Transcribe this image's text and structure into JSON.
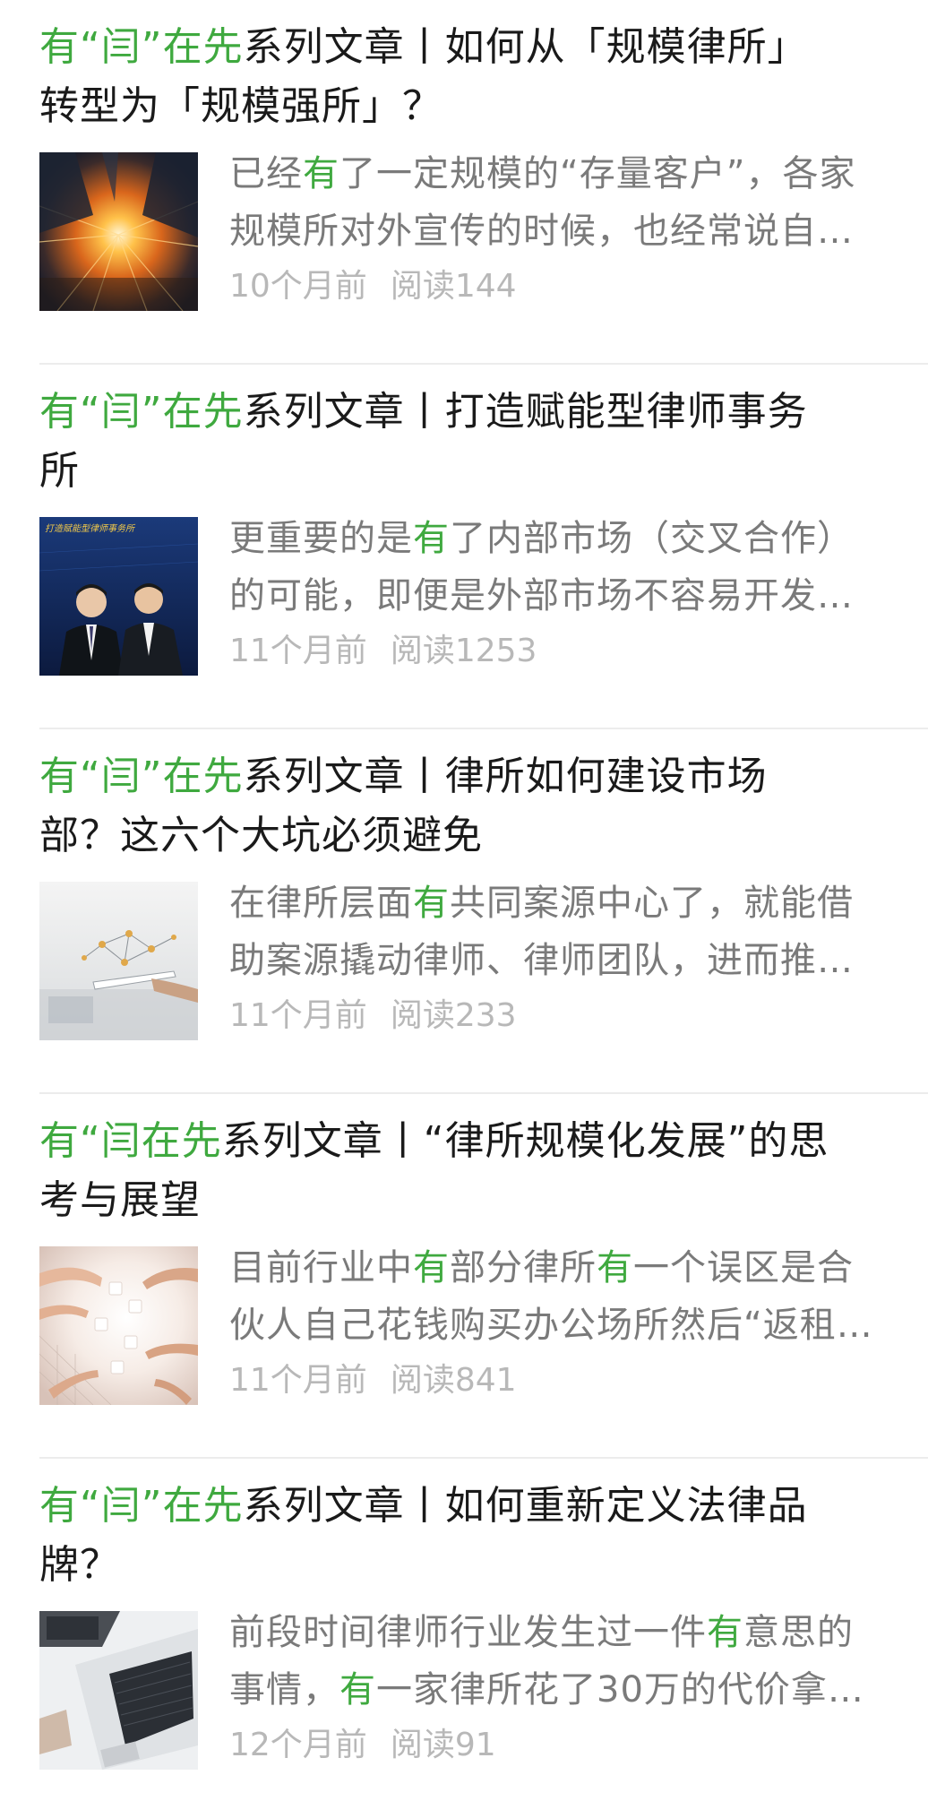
{
  "colors": {
    "highlight": "#3fa93f",
    "title_text": "#1a1a1a",
    "excerpt_text": "#7a7a7a",
    "meta_text": "#b8b8b8",
    "divider": "#ececec"
  },
  "articles": [
    {
      "title_prefix": "有“闫”在先",
      "title_rest_line1": "系列文章丨如何从「规模律所」",
      "title_line2": "转型为「规模强所」？",
      "thumbnail_icon": "city-sunrise-image",
      "excerpt_line1_pre": "已经",
      "excerpt_line1_hl": "有",
      "excerpt_line1_post": "了一定规模的“存量客户”，各家",
      "excerpt_line2": "规模所对外宣传的时候，也经常说自…",
      "time_ago": "10个月前",
      "reads": "阅读144"
    },
    {
      "title_prefix": "有“闫”在先",
      "title_rest_line1": "系列文章丨打造赋能型律师事务",
      "title_line2": "所",
      "thumbnail_icon": "two-lawyers-poster-image",
      "thumbnail_caption": "打造赋能型律师事务所",
      "excerpt_line1_pre": "更重要的是",
      "excerpt_line1_hl": "有",
      "excerpt_line1_post": "了内部市场（交叉合作）",
      "excerpt_line2": "的可能，即便是外部市场不容易开发…",
      "time_ago": "11个月前",
      "reads": "阅读1253"
    },
    {
      "title_prefix": "有“闫”在先",
      "title_rest_line1": "系列文章丨律所如何建设市场",
      "title_line2": "部？这六个大坑必须避免",
      "thumbnail_icon": "tablet-network-image",
      "excerpt_line1_pre": "在律所层面",
      "excerpt_line1_hl": "有",
      "excerpt_line1_post": "共同案源中心了，就能借",
      "excerpt_line2": "助案源撬动律师、律师团队，进而推…",
      "time_ago": "11个月前",
      "reads": "阅读233"
    },
    {
      "title_prefix": "有“闫在先",
      "title_rest_line1": "系列文章丨“律所规模化发展”的思",
      "title_line2": "考与展望",
      "thumbnail_icon": "hands-puzzle-image",
      "excerpt_line1_pre": "目前行业中",
      "excerpt_line1_hl": "有",
      "excerpt_line1_mid": "部分律所",
      "excerpt_line1_hl2": "有",
      "excerpt_line1_post": "一个误区是合",
      "excerpt_line2": "伙人自己花钱购买办公场所然后“返租…",
      "time_ago": "11个月前",
      "reads": "阅读841"
    },
    {
      "title_prefix": "有“闫”在先",
      "title_rest_line1": "系列文章丨如何重新定义法律品",
      "title_line2": "牌？",
      "thumbnail_icon": "laptop-desk-image",
      "excerpt_line1_pre": "前段时间律师行业发生过一件",
      "excerpt_line1_hl": "有",
      "excerpt_line1_post": "意思的",
      "excerpt_line2_pre": "事情，",
      "excerpt_line2_hl": "有",
      "excerpt_line2_post": "一家律所花了30万的代价拿…",
      "time_ago": "12个月前",
      "reads": "阅读91"
    }
  ]
}
